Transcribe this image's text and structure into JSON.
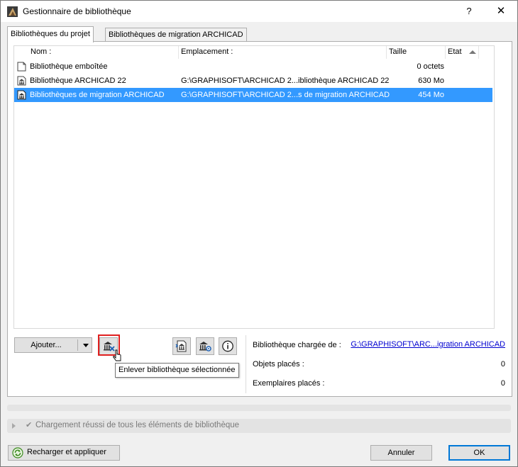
{
  "window": {
    "title": "Gestionnaire de bibliothèque",
    "help_label": "?",
    "close_label": "✕"
  },
  "tabs": [
    {
      "label": "Bibliothèques du projet",
      "active": true
    },
    {
      "label": "Bibliothèques de migration ARCHICAD",
      "active": false
    }
  ],
  "list": {
    "columns": [
      "Nom :",
      "Emplacement :",
      "Taille",
      "Etat"
    ],
    "rows": [
      {
        "name": "Bibliothèque emboîtée",
        "location": "",
        "size": "0 octets",
        "icon": "embedded-library-icon",
        "selected": false
      },
      {
        "name": "Bibliothèque ARCHICAD 22",
        "location": "G:\\GRAPHISOFT\\ARCHICAD 2...ibliothèque ARCHICAD 22",
        "size": "630 Mo",
        "icon": "library-icon",
        "selected": false
      },
      {
        "name": "Bibliothèques de migration ARCHICAD",
        "location": "G:\\GRAPHISOFT\\ARCHICAD 2...s de migration ARCHICAD",
        "size": "454 Mo",
        "icon": "library-icon",
        "selected": true
      }
    ]
  },
  "buttons": {
    "add_label": "Ajouter...",
    "remove_icon": "remove-library-icon",
    "tooltip": "Enlever bibliothèque sélectionnée",
    "reload_label": "Recharger et appliquer",
    "cancel_label": "Annuler",
    "ok_label": "OK"
  },
  "info": {
    "loaded_from_label": "Bibliothèque chargée de :",
    "loaded_from_value": "G:\\GRAPHISOFT\\ARC...igration ARCHICAD",
    "placed_objects_label": "Objets placés :",
    "placed_objects_value": "0",
    "placed_instances_label": "Exemplaires placés :",
    "placed_instances_value": "0"
  },
  "status": {
    "message": "Chargement réussi de tous les éléments de bibliothèque"
  },
  "colors": {
    "selection": "#3399ff",
    "highlight_border": "#e02020",
    "link": "#0000d0",
    "default_button_border": "#0078d7"
  }
}
